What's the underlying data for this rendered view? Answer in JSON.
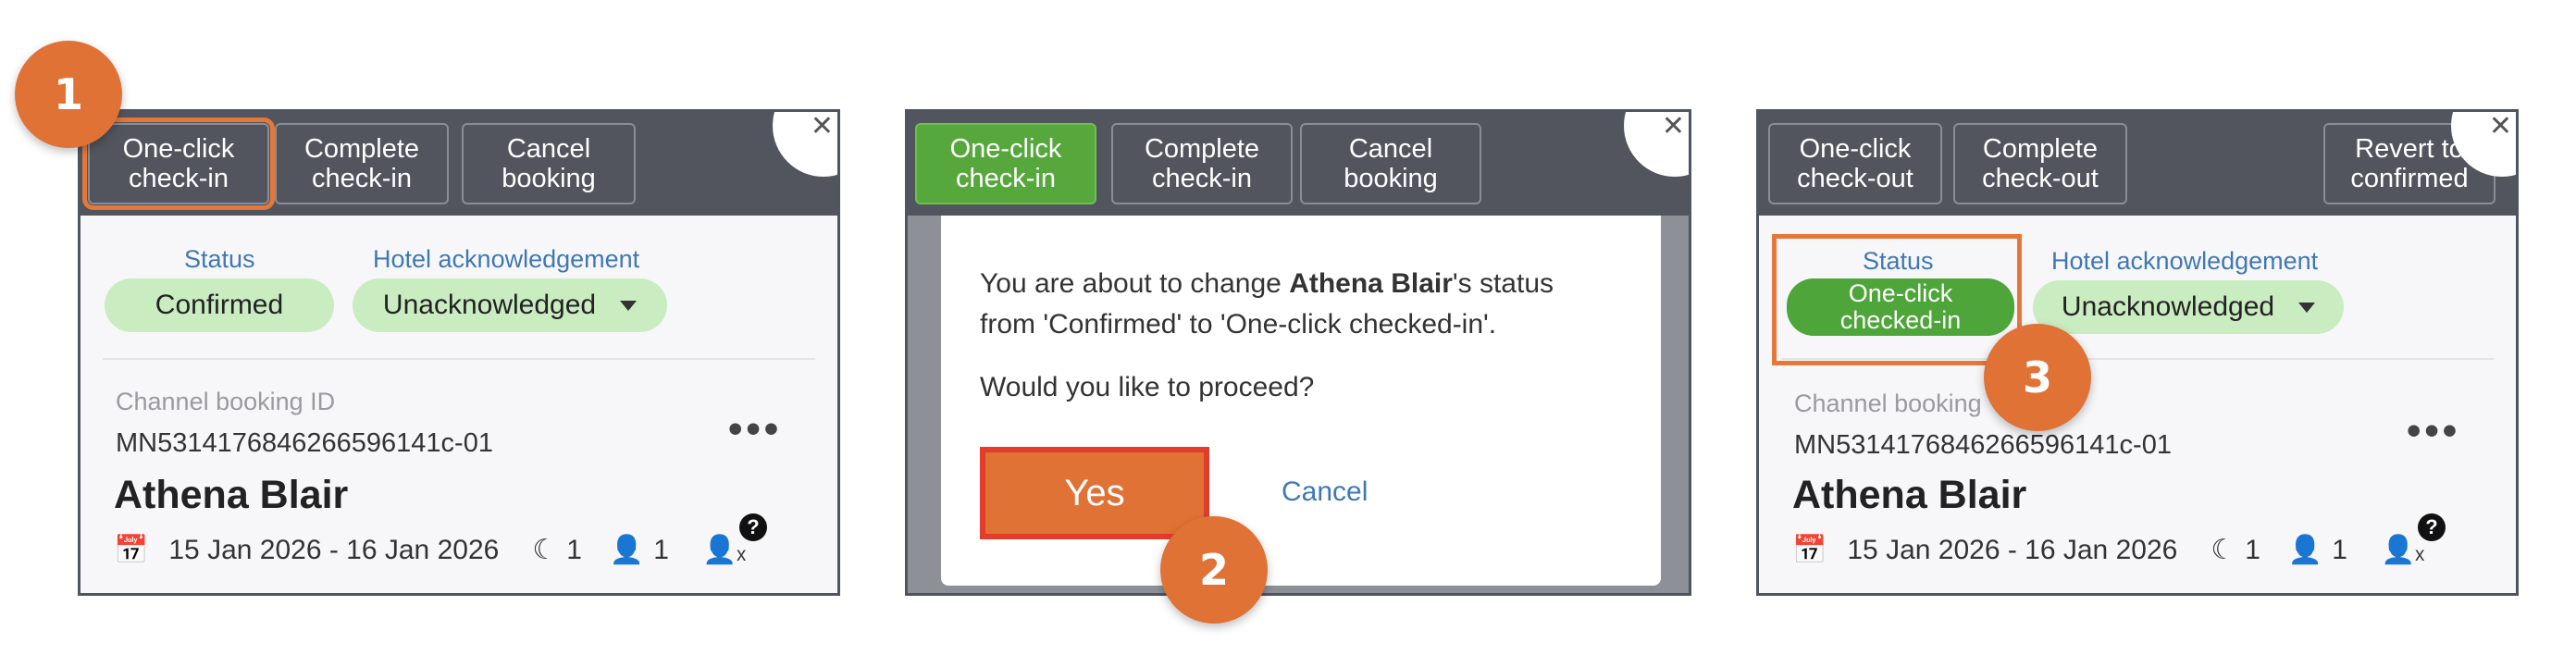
{
  "panel1": {
    "buttons": {
      "one_click": "One-click\ncheck-in",
      "complete": "Complete\ncheck-in",
      "cancel": "Cancel\nbooking"
    },
    "status_label": "Status",
    "status_value": "Confirmed",
    "hotel_ack_label": "Hotel acknowledgement",
    "hotel_ack_value": "Unacknowledged",
    "channel_id_label": "Channel booking ID",
    "channel_id": "MN5314176846266596141c-01",
    "guest_name": "Athena Blair",
    "dates": "15 Jan 2026 - 16 Jan 2026",
    "nights": "1",
    "guests": "1"
  },
  "panel2": {
    "buttons": {
      "one_click": "One-click\ncheck-in",
      "complete": "Complete\ncheck-in",
      "cancel": "Cancel\nbooking"
    },
    "dialog": {
      "line1_pre": "You are about to change ",
      "line1_name": "Athena Blair",
      "line1_post": "'s status",
      "line2": "from 'Confirmed' to 'One-click checked-in'.",
      "question": "Would you like to proceed?",
      "yes": "Yes",
      "cancel": "Cancel"
    }
  },
  "panel3": {
    "buttons": {
      "one_click": "One-click\ncheck-out",
      "complete": "Complete\ncheck-out",
      "revert": "Revert to\nconfirmed"
    },
    "status_label": "Status",
    "status_value": "One-click\nchecked-in",
    "hotel_ack_label": "Hotel acknowledgement",
    "hotel_ack_value": "Unacknowledged",
    "channel_id_label": "Channel booking",
    "channel_id": "MN5314176846266596141c-01",
    "guest_name": "Athena Blair",
    "dates": "15 Jan 2026 - 16 Jan 2026",
    "nights": "1",
    "guests": "1"
  },
  "steps": [
    "1",
    "2",
    "3"
  ],
  "colors": {
    "accent_orange": "#e07236",
    "green_button": "#56a83c",
    "pill_green": "#c9ecc1",
    "topbar": "#52555e",
    "link_blue": "#3f78b4"
  },
  "icons": {
    "calendar": "calendar-icon",
    "moon": "moon-icon",
    "person": "person-icon",
    "user_x": "user-x-icon",
    "help": "help-icon",
    "close": "close-icon",
    "more": "more-icon",
    "caret": "caret-down-icon"
  }
}
